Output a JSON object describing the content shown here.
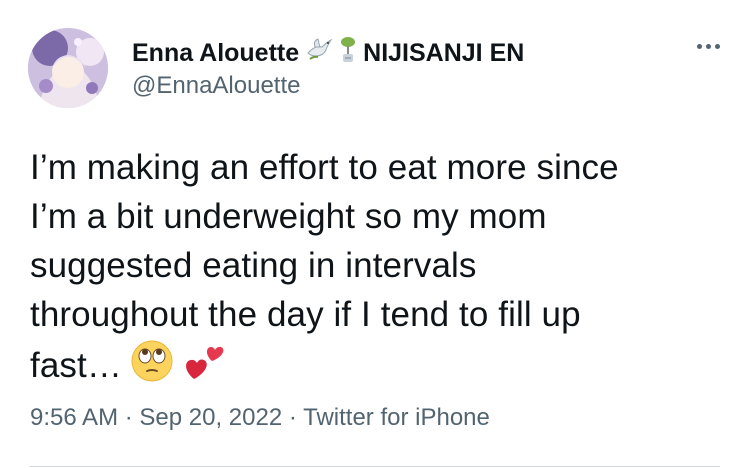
{
  "author": {
    "display_name": "Enna Alouette",
    "badge_icons": [
      "dove-icon",
      "wind-chime-icon"
    ],
    "affiliation": "NIJISANJI EN",
    "handle": "@EnnaAlouette"
  },
  "tweet": {
    "lines": [
      "I’m making an effort to eat more since",
      "I’m a bit underweight so my mom",
      "suggested eating in intervals",
      "throughout the day if I tend to fill up",
      "fast…"
    ],
    "emojis": [
      "face-with-rolling-eyes-emoji",
      "two-hearts-emoji"
    ]
  },
  "meta": {
    "time": "9:56 AM",
    "separator": "·",
    "date": "Sep 20, 2022",
    "source": "Twitter for iPhone"
  },
  "colors": {
    "text": "#0f1419",
    "secondary": "#536471",
    "divider": "#cfd9de"
  }
}
